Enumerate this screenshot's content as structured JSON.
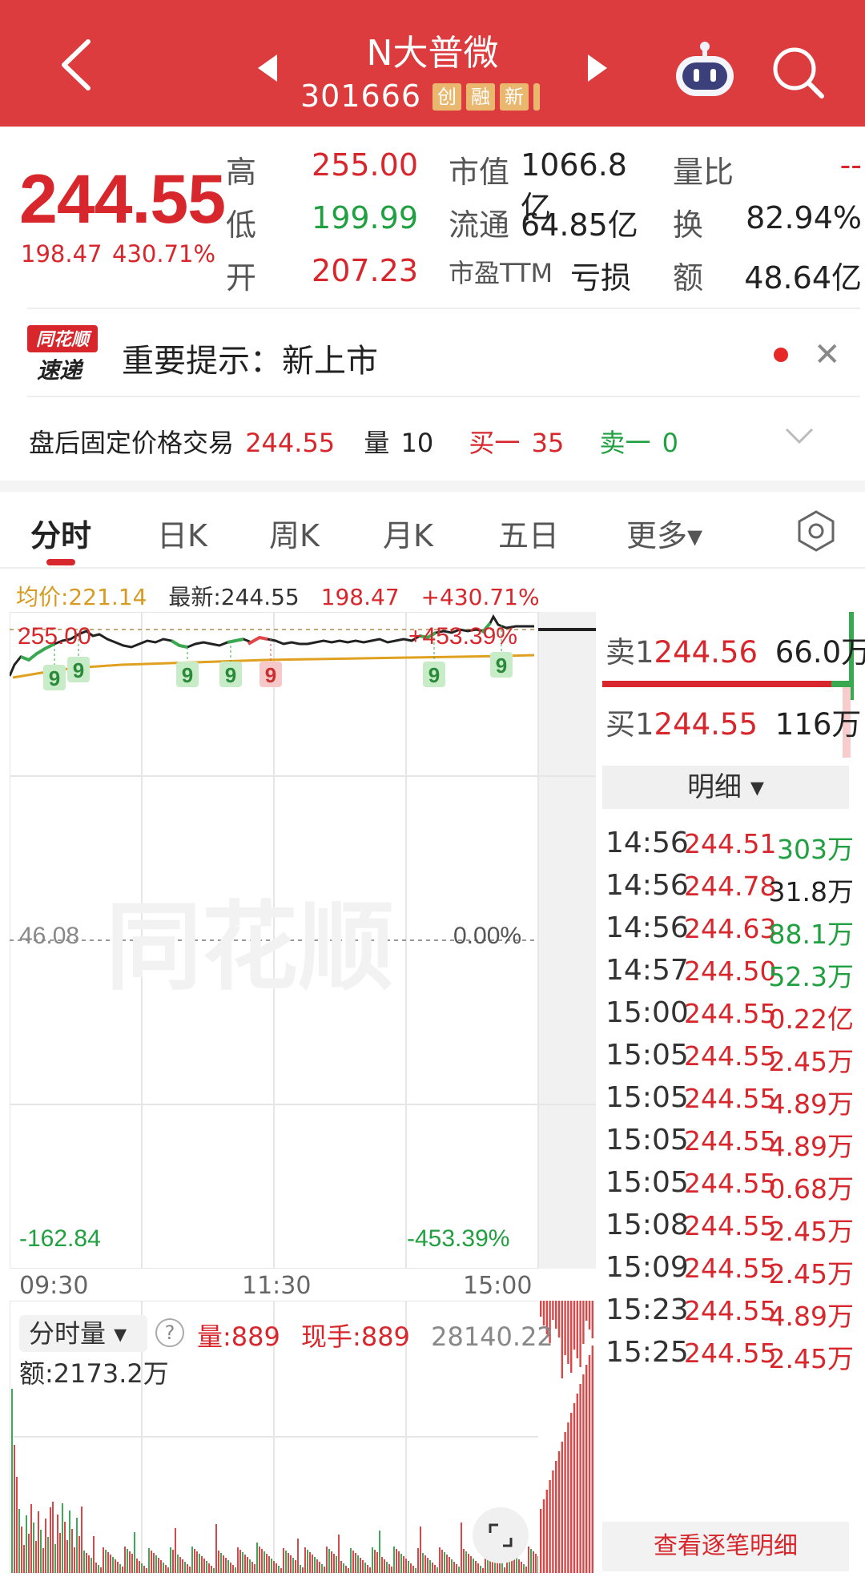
{
  "header": {
    "title": "N大普微",
    "code": "301666",
    "badges": [
      "创",
      "融",
      "新"
    ]
  },
  "quote": {
    "last": "244.55",
    "change": "198.47",
    "change_pct": "430.71%",
    "high_label": "高",
    "high": "255.00",
    "low_label": "低",
    "low": "199.99",
    "open_label": "开",
    "open": "207.23",
    "mcap_label": "市值",
    "mcap": "1066.8亿",
    "float_label": "流通",
    "float": "64.85亿",
    "pe_label": "市盈TTM",
    "pe": "亏损",
    "volratio_label": "量比",
    "volratio": "--",
    "turnover_label": "换",
    "turnover": "82.94%",
    "amount_label": "额",
    "amount": "48.64亿"
  },
  "notice": {
    "logo_top": "同花顺",
    "logo_bottom": "速递",
    "text": "重要提示：新上市"
  },
  "after_hours": {
    "label": "盘后固定价格交易",
    "price": "244.55",
    "vol_label": "量",
    "vol": "10",
    "buy_label": "买一",
    "buy": "35",
    "sell_label": "卖一",
    "sell": "0"
  },
  "tabs": [
    "分时",
    "日K",
    "周K",
    "月K",
    "五日",
    "更多▾"
  ],
  "info_bar": {
    "avg": "均价:221.14",
    "latest": "最新:244.55",
    "change": "198.47",
    "change_pct": "+430.71%"
  },
  "chart_labels": {
    "top_price": "255.00",
    "top_pct": "+453.39%",
    "mid_price": "46.08",
    "mid_pct": "0.00%",
    "bottom_price": "-162.84",
    "bottom_pct": "-453.39%",
    "times": [
      "09:30",
      "11:30",
      "15:00"
    ],
    "markers": [
      "9",
      "9",
      "9",
      "9",
      "9",
      "9",
      "9"
    ],
    "watermark": "同花顺"
  },
  "volume": {
    "selector": "分时量 ▾",
    "help": "?",
    "vol": "量:889",
    "hand": "现手:889",
    "max": "28140.22",
    "amount": "额:2173.2万"
  },
  "orderbook": {
    "sell1_label": "卖1",
    "sell1_price": "244.56",
    "sell1_vol": "66.0万",
    "buy1_label": "买1",
    "buy1_price": "244.55",
    "buy1_vol": "116万"
  },
  "detail": {
    "header": "明细 ▾",
    "view_all": "查看逐笔明细",
    "rows": [
      {
        "time": "14:56",
        "price": "244.51",
        "vol": "303万",
        "dir": "green"
      },
      {
        "time": "14:56",
        "price": "244.78",
        "vol": "31.8万",
        "dir": "dark"
      },
      {
        "time": "14:56",
        "price": "244.63",
        "vol": "88.1万",
        "dir": "green"
      },
      {
        "time": "14:57",
        "price": "244.50",
        "vol": "52.3万",
        "dir": "green"
      },
      {
        "time": "15:00",
        "price": "244.55",
        "vol": "0.22亿",
        "dir": "red"
      },
      {
        "time": "15:05",
        "price": "244.55",
        "vol": "2.45万",
        "dir": "red"
      },
      {
        "time": "15:05",
        "price": "244.55",
        "vol": "4.89万",
        "dir": "red"
      },
      {
        "time": "15:05",
        "price": "244.55",
        "vol": "4.89万",
        "dir": "red"
      },
      {
        "time": "15:05",
        "price": "244.55",
        "vol": "0.68万",
        "dir": "red"
      },
      {
        "time": "15:08",
        "price": "244.55",
        "vol": "2.45万",
        "dir": "red"
      },
      {
        "time": "15:09",
        "price": "244.55",
        "vol": "2.45万",
        "dir": "red"
      },
      {
        "time": "15:23",
        "price": "244.55",
        "vol": "4.89万",
        "dir": "red"
      },
      {
        "time": "15:25",
        "price": "244.55",
        "vol": "2.45万",
        "dir": "red"
      }
    ]
  },
  "colors": {
    "up": "#d8272c",
    "down": "#20a040",
    "avg_line": "#e0a020",
    "header_bg": "#dc3c3e"
  }
}
